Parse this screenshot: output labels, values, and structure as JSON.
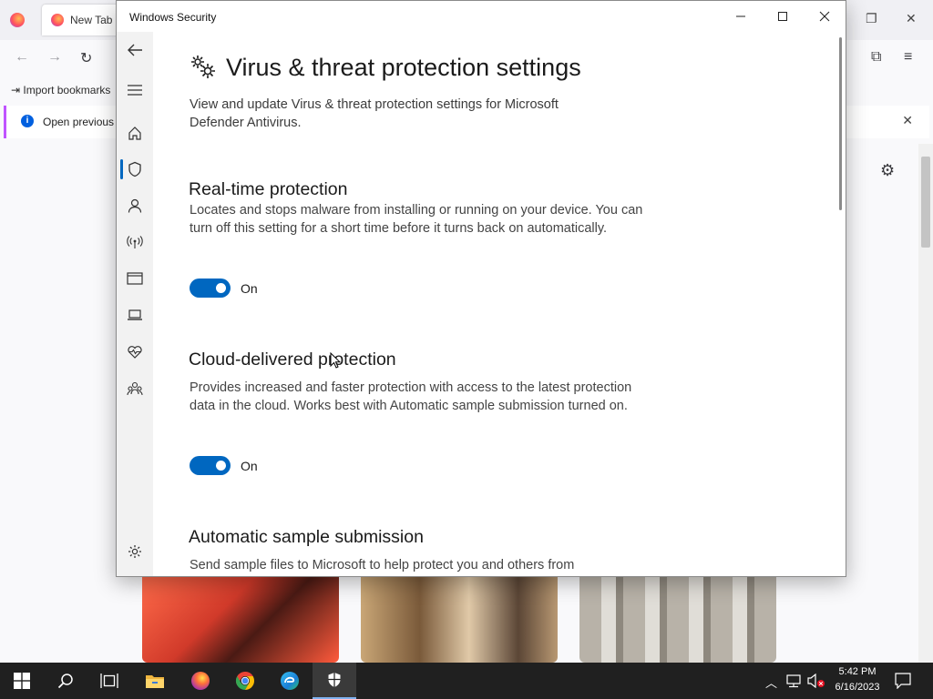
{
  "browser": {
    "tab_label": "New Tab",
    "bookmark_label": "Import bookmarks",
    "notice_text": "Open previous t"
  },
  "window": {
    "title": "Windows Security",
    "controls": {
      "minimize": "—",
      "maximize": "☐",
      "close": "✕"
    }
  },
  "sidebar": {
    "items": [
      {
        "name": "back",
        "icon": "back-arrow-icon"
      },
      {
        "name": "menu",
        "icon": "hamburger-icon"
      },
      {
        "name": "home",
        "icon": "home-icon"
      },
      {
        "name": "virus-protection",
        "icon": "shield-icon",
        "active": true
      },
      {
        "name": "account-protection",
        "icon": "person-icon"
      },
      {
        "name": "firewall",
        "icon": "wifi-antenna-icon"
      },
      {
        "name": "app-browser-control",
        "icon": "browser-window-icon"
      },
      {
        "name": "device-security",
        "icon": "laptop-icon"
      },
      {
        "name": "device-performance",
        "icon": "heart-pulse-icon"
      },
      {
        "name": "family-options",
        "icon": "family-icon"
      },
      {
        "name": "settings",
        "icon": "gear-icon"
      }
    ]
  },
  "main": {
    "page_title": "Virus & threat protection settings",
    "intro": "View and update Virus & threat protection settings for Microsoft Defender Antivirus.",
    "sections": [
      {
        "title": "Real-time protection",
        "description": "Locates and stops malware from installing or running on your device. You can turn off this setting for a short time before it turns back on automatically.",
        "toggle_state": "On"
      },
      {
        "title": "Cloud-delivered protection",
        "description": "Provides increased and faster protection with access to the latest protection data in the cloud. Works best with Automatic sample submission turned on.",
        "toggle_state": "On"
      },
      {
        "title": "Automatic sample submission",
        "description": "Send sample files to Microsoft to help protect you and others from"
      }
    ]
  },
  "taskbar": {
    "time": "5:42 PM",
    "date": "6/16/2023"
  },
  "colors": {
    "accent": "#0067c0",
    "taskbar": "#202020"
  }
}
